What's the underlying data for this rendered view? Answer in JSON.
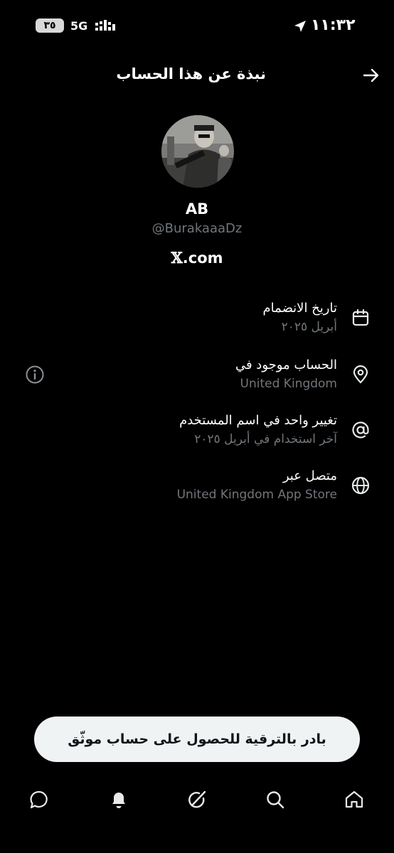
{
  "status_bar": {
    "battery": "٣٥",
    "network": "5G",
    "time": "١١:٣٢",
    "icons": [
      "battery-icon",
      "signal-icon",
      "location-arrow-icon"
    ]
  },
  "header": {
    "title": "نبذة عن هذا الحساب",
    "back_icon": "arrow-right-icon"
  },
  "profile": {
    "name": "AB",
    "handle": "@BurakaaaDz",
    "site_x": "𝕏",
    "site_domain": ".com"
  },
  "info": {
    "joined": {
      "title": "تاريخ الانضمام",
      "value": "أبريل ٢٠٢٥",
      "icon": "calendar-icon"
    },
    "location": {
      "title": "الحساب موجود في",
      "value": "United Kingdom",
      "icon": "location-pin-icon",
      "extra_icon": "info-icon"
    },
    "username": {
      "title": "تغيير واحد في اسم المستخدم",
      "value": "آخر استخدام في أبريل ٢٠٢٥",
      "icon": "at-sign-icon"
    },
    "connected": {
      "title": "متصل عبر",
      "value": "United Kingdom App Store",
      "icon": "globe-icon"
    }
  },
  "upgrade_button": {
    "label": "بادر بالترقية للحصول على حساب موثّق"
  },
  "bottom_nav": [
    "messages-icon",
    "notifications-icon",
    "grok-icon",
    "search-icon",
    "home-icon"
  ],
  "colors": {
    "background": "#000000",
    "primary_text": "#ffffff",
    "secondary_text": "#71767b",
    "button_bg": "#eff3f4"
  }
}
